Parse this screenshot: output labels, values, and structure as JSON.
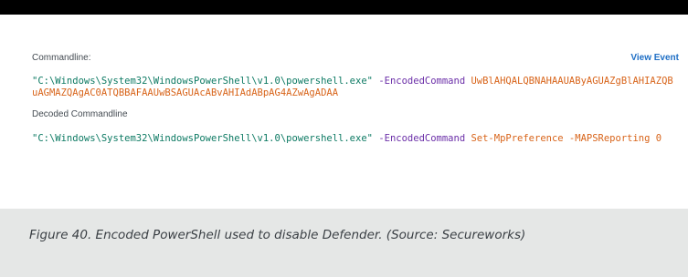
{
  "event": {
    "commandline_label": "Commandline:",
    "view_event_link": "View Event",
    "commandline": {
      "path": "\"C:\\Windows\\System32\\WindowsPowerShell\\v1.0\\powershell.exe\"",
      "flag": "-EncodedCommand",
      "encoded": "UwBlAHQALQBNAHAAUAByAGUAZgBlAHIAZQBuAGMAZQAgAC0ATQBBAFAAUwBSAGUAcABvAHIAdABpAG4AZwAgADAA"
    },
    "decoded_label": "Decoded Commandline",
    "decoded_commandline": {
      "path": "\"C:\\Windows\\System32\\WindowsPowerShell\\v1.0\\powershell.exe\"",
      "flag": "-EncodedCommand",
      "argument": "Set-MpPreference -MAPSReporting 0"
    }
  },
  "caption": "Figure 40. Encoded PowerShell used to disable Defender. (Source: Secureworks)",
  "colors": {
    "path": "#0d7a63",
    "flag": "#6b2fa8",
    "encoded": "#d8641a",
    "link": "#1f6fc5",
    "caption_bg": "#e5e7e6"
  }
}
